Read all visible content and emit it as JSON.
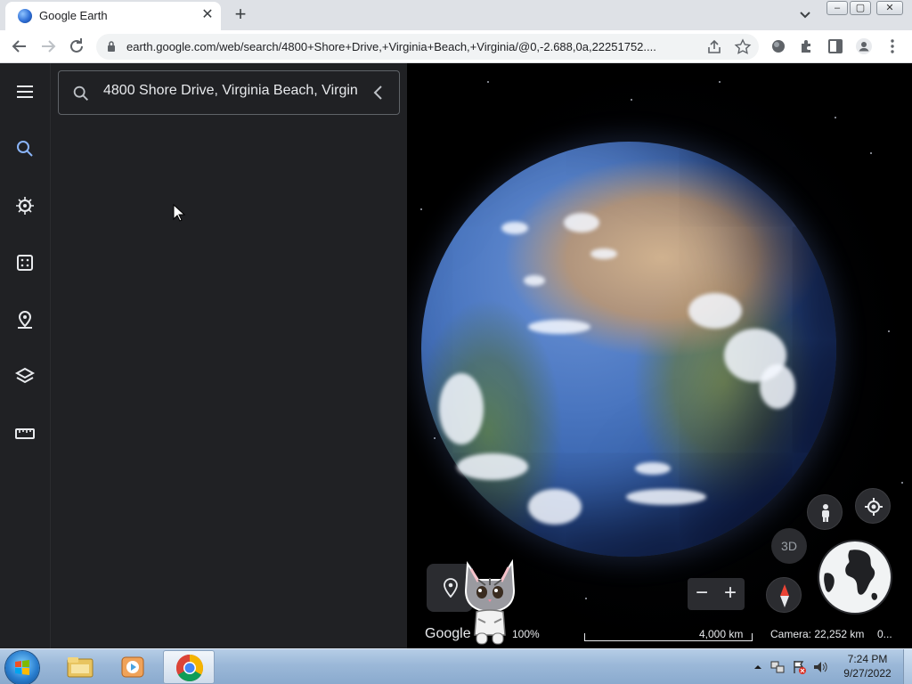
{
  "browser": {
    "tab_title": "Google Earth",
    "tab_close": "✕",
    "new_tab": "+",
    "url": "earth.google.com/web/search/4800+Shore+Drive,+Virginia+Beach,+Virginia/@0,-2.688,0a,22251752....",
    "window_controls": [
      "–",
      "▢",
      "✕"
    ]
  },
  "earth": {
    "search_value": "4800 Shore Drive, Virginia Beach, Virgin",
    "rail_icons": [
      "menu-icon",
      "search-icon",
      "voyager-icon",
      "feeling-lucky-icon",
      "projects-icon",
      "map-style-icon",
      "measure-icon"
    ],
    "attribution": "Google",
    "zoom_percent": "100%",
    "scale_label": "4,000 km",
    "camera": "Camera: 22,252 km",
    "coordinates_truncated": "0...",
    "btn_3d": "3D",
    "zoom_out": "−",
    "zoom_in": "+"
  },
  "taskbar": {
    "time": "7:24 PM",
    "date": "9/27/2022",
    "apps": [
      "file-explorer-icon",
      "media-player-icon",
      "chrome-icon"
    ]
  },
  "colors": {
    "panel_bg": "#202124",
    "text_light": "#e8eaed",
    "chrome_tab_strip": "#dee1e6",
    "accent_blue": "#8ab4f8"
  }
}
